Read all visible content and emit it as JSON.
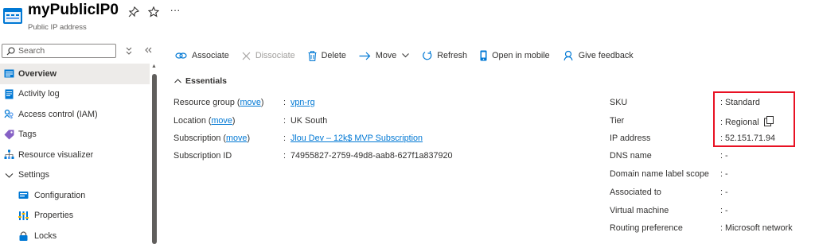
{
  "header": {
    "title": "myPublicIP0",
    "subtitle": "Public IP address",
    "more": "···"
  },
  "sidebar": {
    "search_placeholder": "Search",
    "items": [
      {
        "label": "Overview",
        "icon": "overview-icon",
        "active": true
      },
      {
        "label": "Activity log",
        "icon": "activity-log-icon"
      },
      {
        "label": "Access control (IAM)",
        "icon": "iam-icon"
      },
      {
        "label": "Tags",
        "icon": "tag-icon"
      },
      {
        "label": "Resource visualizer",
        "icon": "visualizer-icon"
      },
      {
        "label": "Settings",
        "icon": "chevron-down-icon"
      },
      {
        "label": "Configuration",
        "icon": "configuration-icon"
      },
      {
        "label": "Properties",
        "icon": "properties-icon"
      },
      {
        "label": "Locks",
        "icon": "lock-icon"
      }
    ]
  },
  "toolbar": {
    "associate": "Associate",
    "dissociate": "Dissociate",
    "delete": "Delete",
    "move": "Move",
    "refresh": "Refresh",
    "open_mobile": "Open in mobile",
    "feedback": "Give feedback"
  },
  "essentials": {
    "title": "Essentials",
    "left": [
      {
        "key": "Resource group",
        "key_link": "move",
        "value": "vpn-rg",
        "value_link": true
      },
      {
        "key": "Location",
        "key_link": "move",
        "value": "UK South",
        "value_link": false
      },
      {
        "key": "Subscription",
        "key_link": "move",
        "value": "Jlou Dev – 12k$ MVP Subscription",
        "value_link": true
      },
      {
        "key": "Subscription ID",
        "key_link": "",
        "value": "74955827-2759-49d8-aab8-627f1a837920",
        "value_link": false
      }
    ],
    "right": [
      {
        "key": "SKU",
        "value": "Standard"
      },
      {
        "key": "Tier",
        "value": "Regional"
      },
      {
        "key": "IP address",
        "value": "52.151.71.94"
      },
      {
        "key": "DNS name",
        "value": "-"
      },
      {
        "key": "Domain name label scope",
        "value": "-"
      },
      {
        "key": "Associated to",
        "value": "-"
      },
      {
        "key": "Virtual machine",
        "value": "-"
      },
      {
        "key": "Routing preference",
        "value": "Microsoft network"
      }
    ]
  },
  "colors": {
    "accent": "#0078d4",
    "highlight": "#e81123"
  }
}
